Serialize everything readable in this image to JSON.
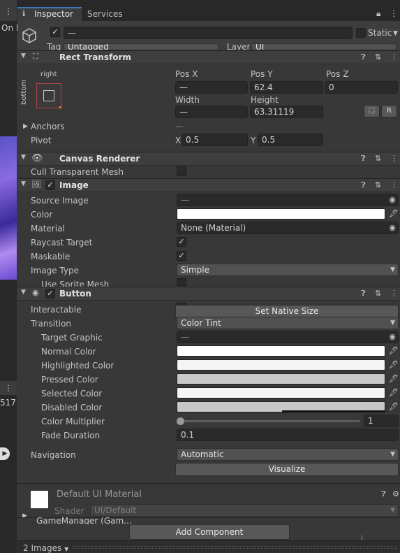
{
  "tabs": [
    {
      "label": "Inspector"
    },
    {
      "label": "Services"
    }
  ],
  "left_edge": {
    "label1": "On I",
    "label2": "517"
  },
  "object": {
    "name": "—",
    "static_label": "Static",
    "tag_label": "Tag",
    "tag_value": "Untagged",
    "layer_label": "Layer",
    "layer_value": "UI"
  },
  "rect": {
    "title": "Rect Transform",
    "anchor_x": "right",
    "anchor_y": "bottom",
    "posx_label": "Pos X",
    "posy_label": "Pos Y",
    "posz_label": "Pos Z",
    "posx": "—",
    "posy": "62.4",
    "posz": "0",
    "width_label": "Width",
    "height_label": "Height",
    "width": "—",
    "height": "63.31119",
    "r_button": "R",
    "anchors_label": "Anchors",
    "anchors_value": "—",
    "pivot_label": "Pivot",
    "pivot_x_label": "X",
    "pivot_x": "0.5",
    "pivot_y_label": "Y",
    "pivot_y": "0.5"
  },
  "canvas": {
    "title": "Canvas Renderer",
    "cull_label": "Cull Transparent Mesh"
  },
  "image": {
    "title": "Image",
    "source_label": "Source Image",
    "source_value": "—",
    "color_label": "Color",
    "color": "#ffffff",
    "material_label": "Material",
    "material_value": "None (Material)",
    "raycast_label": "Raycast Target",
    "maskable_label": "Maskable",
    "type_label": "Image Type",
    "type_value": "Simple",
    "sprite_mesh_label": "Use Sprite Mesh"
  },
  "button": {
    "title": "Button",
    "native_size": "Set Native Size",
    "interactable_label": "Interactable",
    "transition_label": "Transition",
    "transition_value": "Color Tint",
    "target_label": "Target Graphic",
    "target_value": "—",
    "colors": [
      {
        "label": "Normal Color",
        "color": "#ffffff"
      },
      {
        "label": "Highlighted Color",
        "color": "#f5f5f5"
      },
      {
        "label": "Pressed Color",
        "color": "#c8c8c8"
      },
      {
        "label": "Selected Color",
        "color": "#f5f5f5"
      },
      {
        "label": "Disabled Color",
        "color": "#c8c8c8"
      }
    ],
    "multiplier_label": "Color Multiplier",
    "multiplier_value": "1",
    "fade_label": "Fade Duration",
    "fade_value": "0.1",
    "navigation_label": "Navigation",
    "navigation_value": "Automatic",
    "visualize_label": "Visualize"
  },
  "material": {
    "title": "Default UI Material",
    "shader_label": "Shader",
    "shader_value": "UI/Default"
  },
  "bottom": {
    "gamemanager": "GameManager (Gam...",
    "add_component": "Add Component",
    "images_label": "2 Images"
  }
}
